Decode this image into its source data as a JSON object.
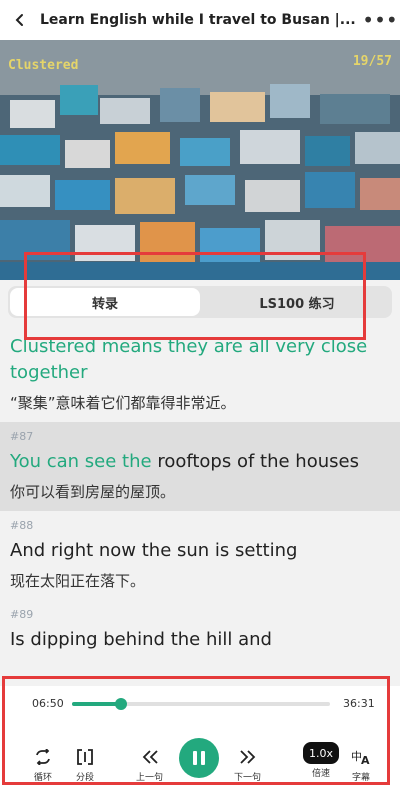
{
  "header": {
    "title": "Learn English while I travel to Busan |...",
    "back_icon": "chevron-left-icon",
    "more_icon": "more-dots-icon"
  },
  "video": {
    "overlay_text": "Clustered",
    "counter": "19/57"
  },
  "tabs": [
    {
      "label": "转录",
      "active": true
    },
    {
      "label": "LS100 练习",
      "active": false
    }
  ],
  "transcript": {
    "segments": [
      {
        "number": "",
        "en": "Clustered means they are all very close together",
        "zh": "“聚集”意味着它们都靠得非常近。"
      },
      {
        "number": "#87",
        "en_highlight": "You can see the",
        "en_rest": " rooftops of the houses",
        "zh": "你可以看到房屋的屋顶。",
        "active": true
      },
      {
        "number": "#88",
        "en": "And right now the sun is setting",
        "zh": "现在太阳正在落下。"
      },
      {
        "number": "#89",
        "en": "Is dipping behind the hill and"
      }
    ]
  },
  "player": {
    "current_time": "06:50",
    "total_time": "36:31",
    "progress": 0.19,
    "controls": {
      "loop": {
        "label": "循环",
        "icon": "loop-icon"
      },
      "segment": {
        "label": "分段",
        "icon": "segment-icon"
      },
      "prev": {
        "label": "上一句",
        "icon": "previous-icon"
      },
      "play": {
        "icon": "pause-icon"
      },
      "next": {
        "label": "下一句",
        "icon": "next-icon"
      },
      "speed": {
        "label": "倍速",
        "value": "1.0x"
      },
      "subtitle": {
        "label": "字幕",
        "icon": "subtitle-icon"
      }
    }
  },
  "colors": {
    "accent": "#23a97e",
    "highlight_box": "#e53b3b"
  }
}
